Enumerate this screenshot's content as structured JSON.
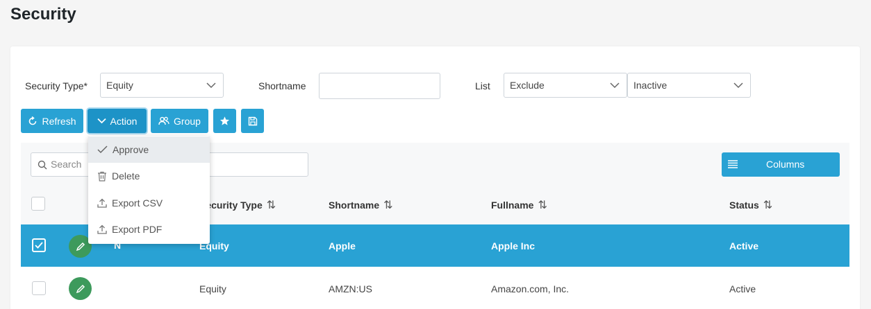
{
  "page": {
    "title": "Security"
  },
  "filters": {
    "security_type_label": "Security Type*",
    "security_type_value": "Equity",
    "shortname_label": "Shortname",
    "shortname_value": "",
    "list_label": "List",
    "list_value": "Exclude",
    "status_value": "Inactive"
  },
  "toolbar": {
    "refresh": "Refresh",
    "action": "Action",
    "group": "Group"
  },
  "action_menu": [
    {
      "label": "Approve",
      "icon": "check-icon"
    },
    {
      "label": "Delete",
      "icon": "trash-icon"
    },
    {
      "label": "Export CSV",
      "icon": "upload-icon"
    },
    {
      "label": "Export PDF",
      "icon": "upload-icon"
    }
  ],
  "grid": {
    "search_placeholder": "Search",
    "columns_button": "Columns",
    "headers": {
      "security_type": "Security Type",
      "shortname": "Shortname",
      "fullname": "Fullname",
      "status": "Status"
    },
    "sort_icon": "⇅",
    "rows": [
      {
        "selected": true,
        "n": "N",
        "security_type": "Equity",
        "shortname": "Apple",
        "fullname": "Apple Inc",
        "status": "Active"
      },
      {
        "selected": false,
        "n": "",
        "security_type": "Equity",
        "shortname": "AMZN:US",
        "fullname": "Amazon.com, Inc.",
        "status": "Active"
      }
    ]
  },
  "colors": {
    "primary": "#29a2d4",
    "edit_green": "#3d9a5c",
    "page_bg": "#f5f5f5"
  }
}
